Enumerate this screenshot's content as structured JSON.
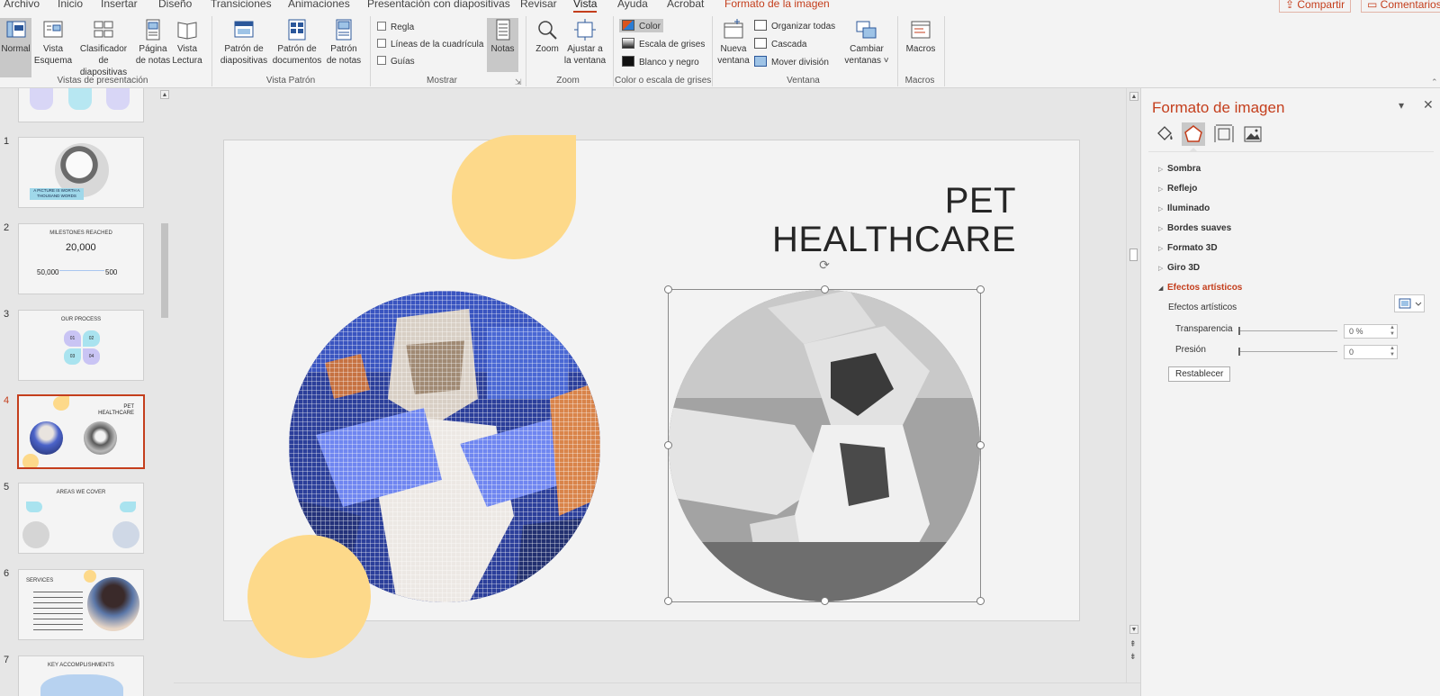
{
  "tabs": [
    "Archivo",
    "Inicio",
    "Insertar",
    "Diseño",
    "Transiciones",
    "Animaciones",
    "Presentación con diapositivas",
    "Revisar",
    "Vista",
    "Ayuda",
    "Acrobat",
    "Formato de la imagen"
  ],
  "active_tab": "Vista",
  "context_tab": "Formato de la imagen",
  "share_label": "Compartir",
  "comments_label": "Comentarios",
  "ribbon": {
    "presentation_views": {
      "label": "Vistas de presentación",
      "normal": "Normal",
      "outline_1": "Vista",
      "outline_2": "Esquema",
      "sorter_1": "Clasificador",
      "sorter_2": "de diapositivas",
      "notes_page_1": "Página",
      "notes_page_2": "de notas",
      "reading_1": "Vista",
      "reading_2": "Lectura"
    },
    "master_views": {
      "label": "Vista Patrón",
      "slide_master_1": "Patrón de",
      "slide_master_2": "diapositivas",
      "handout_master_1": "Patrón de",
      "handout_master_2": "documentos",
      "notes_master_1": "Patrón",
      "notes_master_2": "de notas"
    },
    "show": {
      "label": "Mostrar",
      "ruler": "Regla",
      "gridlines": "Líneas de la cuadrícula",
      "guides": "Guías",
      "notes": "Notas"
    },
    "zoom": {
      "label": "Zoom",
      "zoom": "Zoom",
      "fit_1": "Ajustar a",
      "fit_2": "la ventana"
    },
    "color": {
      "label": "Color o escala de grises",
      "color": "Color",
      "grayscale": "Escala de grises",
      "bw": "Blanco y negro"
    },
    "window": {
      "label": "Ventana",
      "new_1": "Nueva",
      "new_2": "ventana",
      "arrange": "Organizar todas",
      "cascade": "Cascada",
      "move_split": "Mover división",
      "switch_1": "Cambiar",
      "switch_2": "ventanas"
    },
    "macros": {
      "label": "Macros",
      "macros": "Macros"
    }
  },
  "thumbnails": {
    "numbers": [
      "1",
      "2",
      "3",
      "4",
      "5",
      "6",
      "7"
    ],
    "selected": "4",
    "s1_caption_1": "A PICTURE IS WORTH A",
    "s1_caption_2": "THOUSAND WORDS",
    "s2_title": "MILESTONES REACHED",
    "s2_big": "20,000",
    "s2_left": "50,000",
    "s2_right": "500",
    "s3_title": "OUR PROCESS",
    "s3_steps": [
      "01",
      "02",
      "03",
      "04"
    ],
    "s4_title_1": "PET",
    "s4_title_2": "HEALTHCARE",
    "s5_title": "AREAS WE COVER",
    "s6_title": "SERVICES",
    "s7_title": "KEY ACCOMPLISHMENTS"
  },
  "slide": {
    "title_line1": "PET",
    "title_line2": "HEALTHCARE",
    "accent_color": "#fdd98a"
  },
  "pane": {
    "title": "Formato de imagen",
    "sections": [
      "Sombra",
      "Reflejo",
      "Iluminado",
      "Bordes suaves",
      "Formato 3D",
      "Giro 3D"
    ],
    "open_section": "Efectos artísticos",
    "artistic_effects_label": "Efectos artísticos",
    "transparency_label": "Transparencia",
    "transparency_value": "0 %",
    "pressure_label": "Presión",
    "pressure_value": "0",
    "reset_label": "Restablecer"
  },
  "colors": {
    "accent": "#c43e1c",
    "ribbon_bg": "#f3f3f3",
    "workspace": "#e6e6e6"
  }
}
